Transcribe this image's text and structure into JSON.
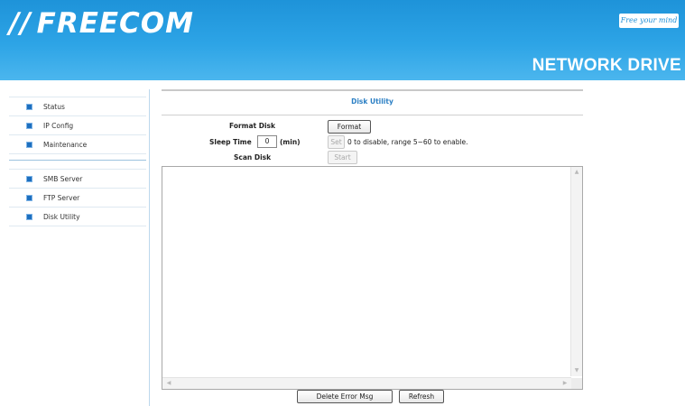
{
  "header": {
    "logo": "FREECOM",
    "tagline": "Free your mind",
    "product": "NETWORK DRIVE",
    "colors": {
      "banner": "#2da4e6",
      "accent": "#2b7fc4"
    }
  },
  "sidebar": {
    "group1": [
      {
        "label": "Status"
      },
      {
        "label": "IP Config"
      },
      {
        "label": "Maintenance"
      }
    ],
    "group2": [
      {
        "label": "SMB Server"
      },
      {
        "label": "FTP Server"
      },
      {
        "label": "Disk Utility"
      }
    ]
  },
  "main": {
    "title": "Disk Utility",
    "format_label": "Format Disk",
    "format_button": "Format",
    "sleep_label": "Sleep Time",
    "sleep_value": "0",
    "sleep_unit": "(min)",
    "set_button": "Set",
    "sleep_hint": "0 to disable, range 5~60 to enable.",
    "scan_label": "Scan Disk",
    "start_button": "Start",
    "log_text": "",
    "delete_button": "Delete Error Msg",
    "refresh_button": "Refresh"
  }
}
